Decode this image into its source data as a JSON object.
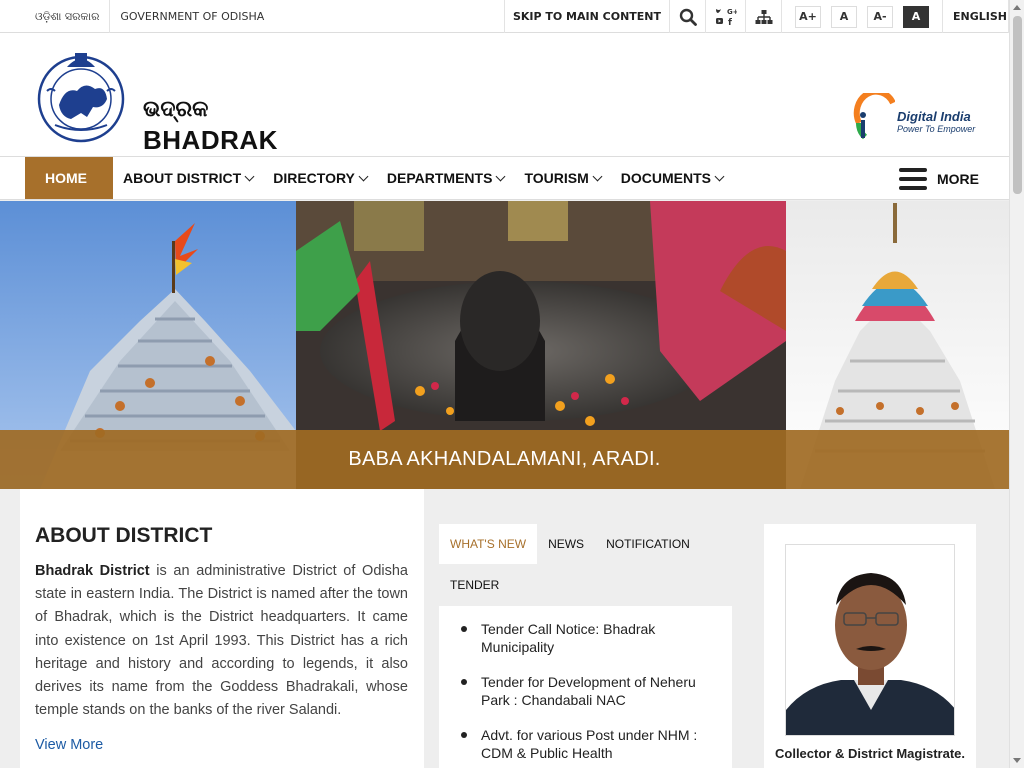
{
  "topbar": {
    "odisha_sarkar": "ଓଡ଼ିଶା ସରକାର",
    "government": "GOVERNMENT OF ODISHA",
    "skip": "SKIP TO MAIN CONTENT",
    "font_increase": "A+",
    "font_normal": "A",
    "font_decrease": "A-",
    "contrast": "A",
    "language": "ENGLISH"
  },
  "header": {
    "site_name_odia": "ଭଦ୍ରକ",
    "site_name": "BHADRAK",
    "digital_india_title": "Digital India",
    "digital_india_tagline": "Power To Empower"
  },
  "nav": {
    "items": [
      {
        "label": "HOME"
      },
      {
        "label": "ABOUT DISTRICT"
      },
      {
        "label": "DIRECTORY"
      },
      {
        "label": "DEPARTMENTS"
      },
      {
        "label": "TOURISM"
      },
      {
        "label": "DOCUMENTS"
      }
    ],
    "more": "MORE"
  },
  "banner": {
    "caption": "BABA AKHANDALAMANI, ARADI."
  },
  "about": {
    "title": "ABOUT DISTRICT",
    "lead": "Bhadrak District",
    "text": " is an administrative District of Odisha state in eastern India. The District is named after the town of Bhadrak, which is the District headquarters. It came into existence on 1st April 1993. This District has a rich heritage and history and according to legends, it also derives its name from the Goddess Bhadrakali, whose temple stands on the banks of the river Salandi.",
    "view_more": "View More"
  },
  "news": {
    "tabs": [
      "WHAT'S NEW",
      "NEWS",
      "NOTIFICATION",
      "TENDER"
    ],
    "items": [
      "Tender Call Notice: Bhadrak Municipality",
      "Tender for Development of Neheru Park : Chandabali NAC",
      "Advt. for various Post under NHM : CDM & Public Health"
    ]
  },
  "collector": {
    "title": "Collector & District Magistrate."
  },
  "colors": {
    "accent": "#a7702b",
    "link": "#1d5ba4"
  }
}
